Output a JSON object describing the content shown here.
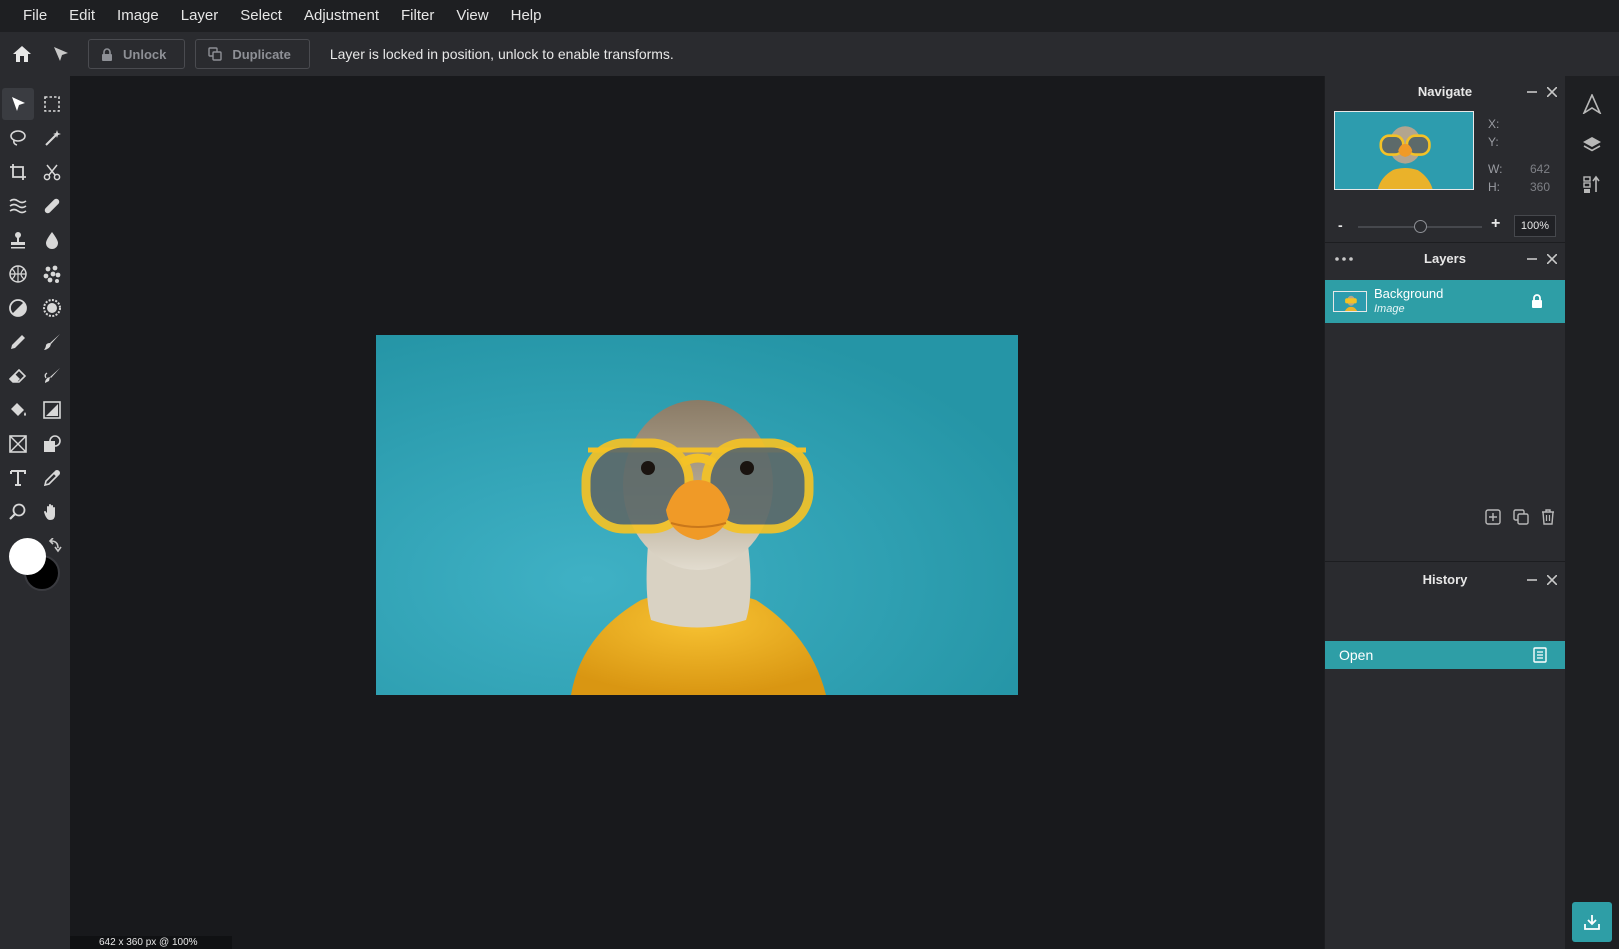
{
  "menubar": {
    "items": [
      "File",
      "Edit",
      "Image",
      "Layer",
      "Select",
      "Adjustment",
      "Filter",
      "View",
      "Help"
    ]
  },
  "toolbar": {
    "unlock_label": "Unlock",
    "duplicate_label": "Duplicate",
    "message": "Layer is locked in position, unlock to enable transforms."
  },
  "tools": [
    "move-select-icon",
    "marquee-select-icon",
    "lasso-icon",
    "magic-wand-icon",
    "crop-icon",
    "scissors-icon",
    "liquify-icon",
    "healing-bandage-icon",
    "clone-stamp-icon",
    "blur-drop-icon",
    "sponge-icon",
    "pattern-icon",
    "dodge-burn-icon",
    "sharpen-icon",
    "pencil-icon",
    "brush-icon",
    "eraser-icon",
    "smudge-icon",
    "fill-bucket-icon",
    "gradient-icon",
    "frame-icon",
    "shape-icon",
    "text-icon",
    "eyedropper-icon",
    "zoom-icon",
    "hand-icon"
  ],
  "colors": {
    "foreground": "#ffffff",
    "background": "#000000",
    "accent": "#2e9ea6"
  },
  "navigate": {
    "title": "Navigate",
    "x_label": "X:",
    "y_label": "Y:",
    "w_label": "W:",
    "h_label": "H:",
    "w_value": "642",
    "h_value": "360",
    "zoom_minus": "-",
    "zoom_plus": "+",
    "zoom_value": "100%",
    "zoom_level": 0.5
  },
  "layers": {
    "title": "Layers",
    "items": [
      {
        "name": "Background",
        "type": "Image",
        "locked": true
      }
    ]
  },
  "history": {
    "title": "History",
    "items": [
      {
        "label": "Open"
      }
    ]
  },
  "status": {
    "text": "642 x 360 px @ 100%"
  }
}
